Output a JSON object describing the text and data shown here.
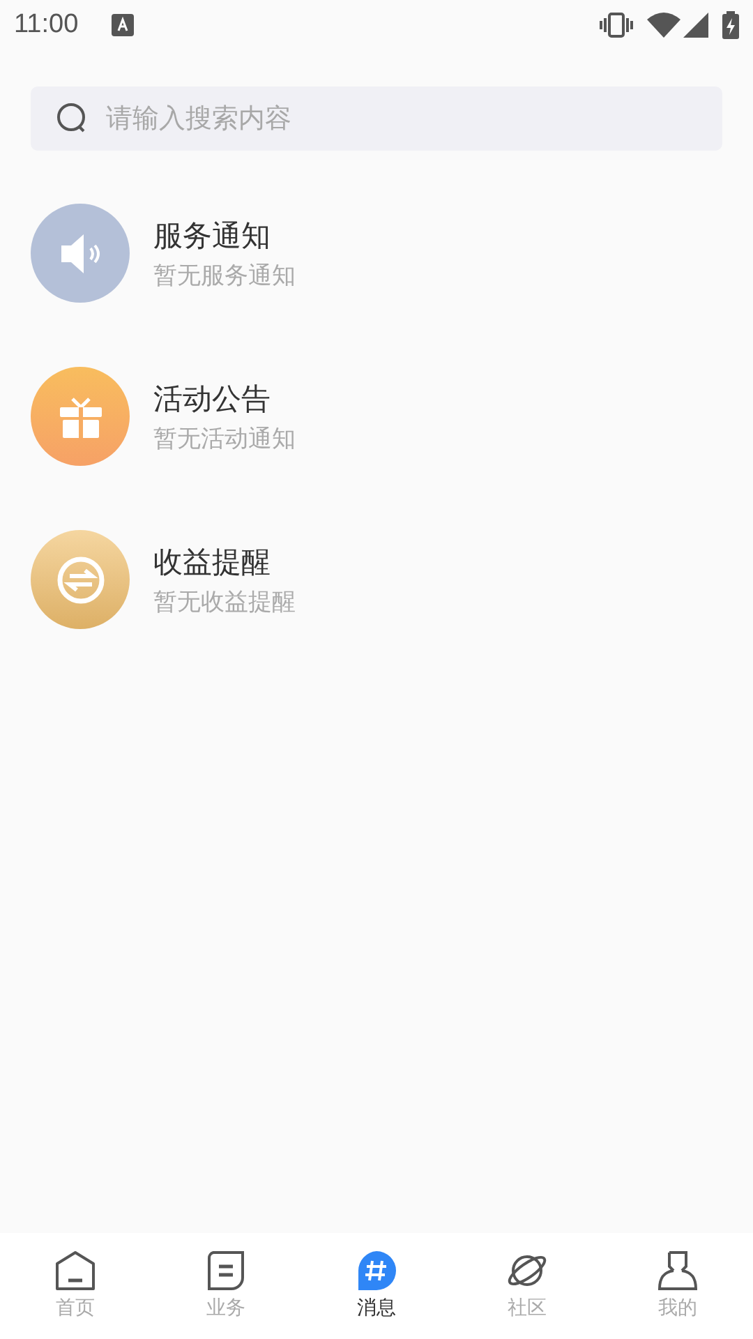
{
  "status_bar": {
    "time": "11:00"
  },
  "search": {
    "placeholder": "请输入搜索内容"
  },
  "messages": [
    {
      "kind": "speaker",
      "title": "服务通知",
      "subtitle": "暂无服务通知"
    },
    {
      "kind": "gift",
      "title": "活动公告",
      "subtitle": "暂无活动通知"
    },
    {
      "kind": "exchange",
      "title": "收益提醒",
      "subtitle": "暂无收益提醒"
    }
  ],
  "tabs": [
    {
      "kind": "home",
      "label": "首页",
      "selected": false
    },
    {
      "kind": "doc",
      "label": "业务",
      "selected": false
    },
    {
      "kind": "chat",
      "label": "消息",
      "selected": true
    },
    {
      "kind": "planet",
      "label": "社区",
      "selected": false
    },
    {
      "kind": "person",
      "label": "我的",
      "selected": false
    }
  ]
}
